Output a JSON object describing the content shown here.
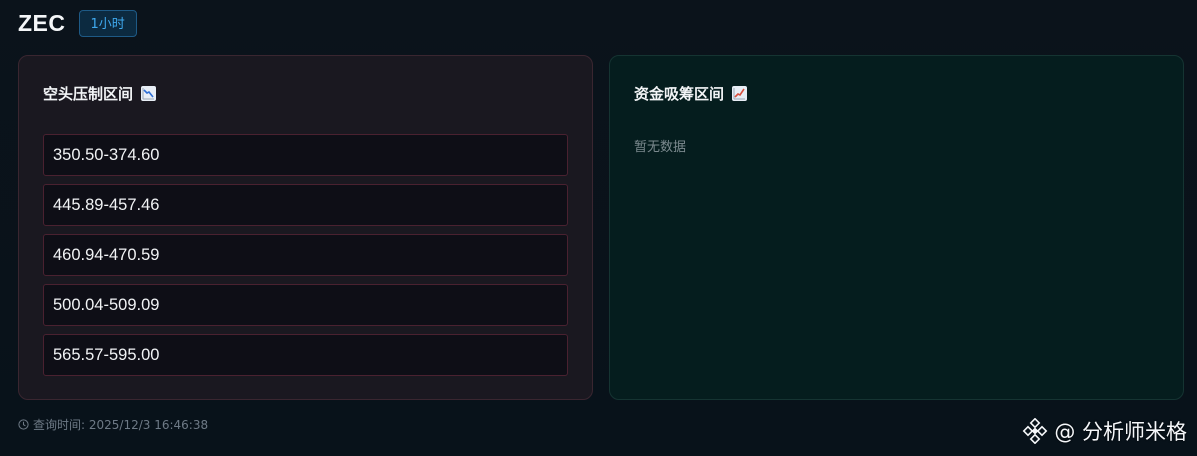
{
  "header": {
    "symbol": "ZEC",
    "timeframe": "1小时"
  },
  "resistance": {
    "title": "空头压制区间",
    "icon": "chart-decreasing-icon",
    "zones": [
      "350.50-374.60",
      "445.89-457.46",
      "460.94-470.59",
      "500.04-509.09",
      "565.57-595.00"
    ]
  },
  "support": {
    "title": "资金吸筹区间",
    "icon": "chart-increasing-icon",
    "empty_text": "暂无数据"
  },
  "footer": {
    "query_time": "查询时间: 2025/12/3 16:46:38"
  },
  "watermark": {
    "text": "@ 分析师米格",
    "icon": "binance-diamond-icon"
  },
  "colors": {
    "accent_blue": "#3fa9ee",
    "resist_border": "#4a2130",
    "support_bg": "#051d1e"
  }
}
